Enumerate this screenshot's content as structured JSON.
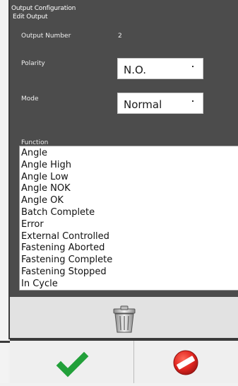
{
  "header": {
    "title": "Output Configuration",
    "subtitle": "Edit Output"
  },
  "fields": {
    "output_number": {
      "label": "Output Number",
      "value": "2"
    },
    "polarity": {
      "label": "Polarity",
      "value": "N.O."
    },
    "mode": {
      "label": "Mode",
      "value": "Normal"
    }
  },
  "function": {
    "label": "Function",
    "items": [
      "Angle",
      "Angle High",
      "Angle Low",
      "Angle NOK",
      "Angle OK",
      "Batch Complete",
      "Error",
      "External Controlled",
      "Fastening Aborted",
      "Fastening Complete",
      "Fastening Stopped",
      "In Cycle"
    ]
  },
  "icons": {
    "delete": "trash-icon",
    "ok": "checkmark-icon",
    "cancel": "no-entry-icon"
  },
  "colors": {
    "panel": "#4c4c4c",
    "ok_green": "#22a03a",
    "cancel_red": "#e0251f"
  }
}
